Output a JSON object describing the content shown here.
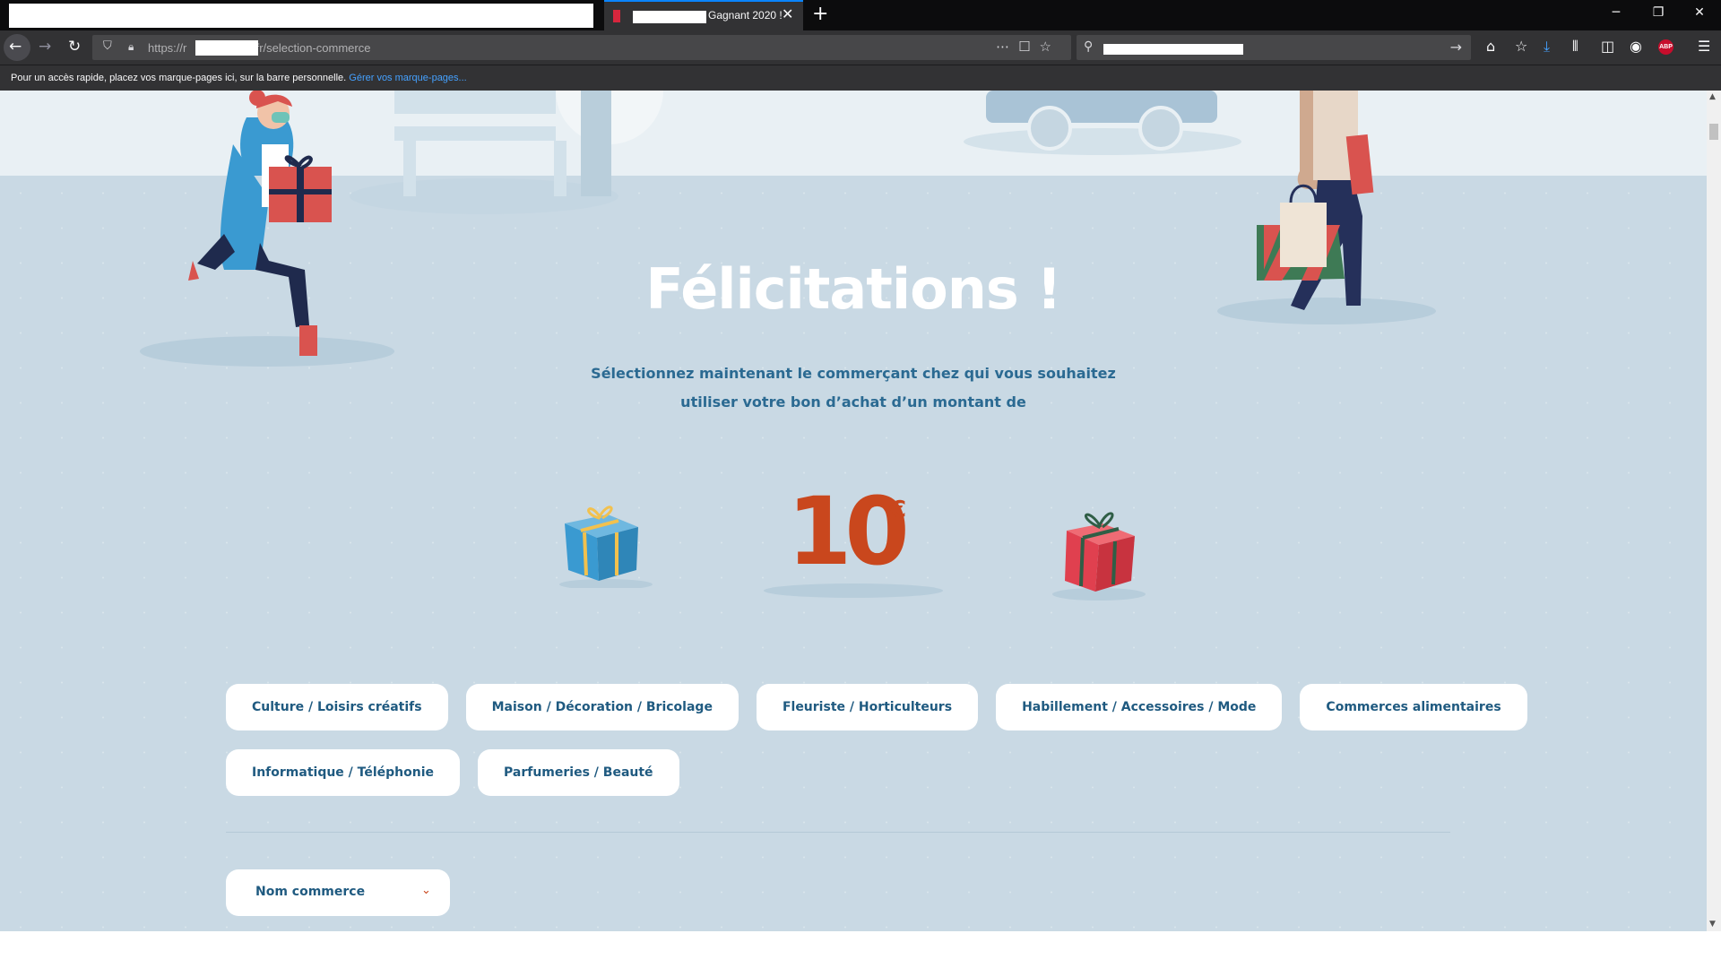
{
  "browser": {
    "tab_title": "Gagnant 2020 !",
    "tab_close": "✕",
    "new_tab": "+",
    "url_prefix": "https://r",
    "url_suffix": "t.fr/selection-commerce",
    "bookmarks_text": "Pour un accès rapide, placez vos marque-pages ici, sur la barre personnelle.",
    "bookmarks_link": "Gérer vos marque-pages...",
    "abp_badge": "ABP",
    "minimize": "─",
    "restore": "❐",
    "close": "✕"
  },
  "hero": {
    "title": "Félicitations !",
    "subtitle_line1": "Sélectionnez maintenant le commerçant chez qui vous souhaitez",
    "subtitle_line2": "utiliser votre bon d’achat d’un montant de",
    "amount": "10",
    "currency": "€"
  },
  "categories": {
    "row1": [
      "Culture / Loisirs créatifs",
      "Maison / Décoration / Bricolage",
      "Fleuriste / Horticulteurs",
      "Habillement / Accessoires / Mode",
      "Commerces alimentaires"
    ],
    "row2": [
      "Informatique / Téléphonie",
      "Parfumeries / Beauté"
    ]
  },
  "shop_select": {
    "label": "Nom commerce"
  },
  "colors": {
    "background": "#c9d9e4",
    "accent": "#c9471d",
    "text_blue": "#1f5a80",
    "gift_blue": "#3a9ad1",
    "gift_red": "#e0404f"
  }
}
